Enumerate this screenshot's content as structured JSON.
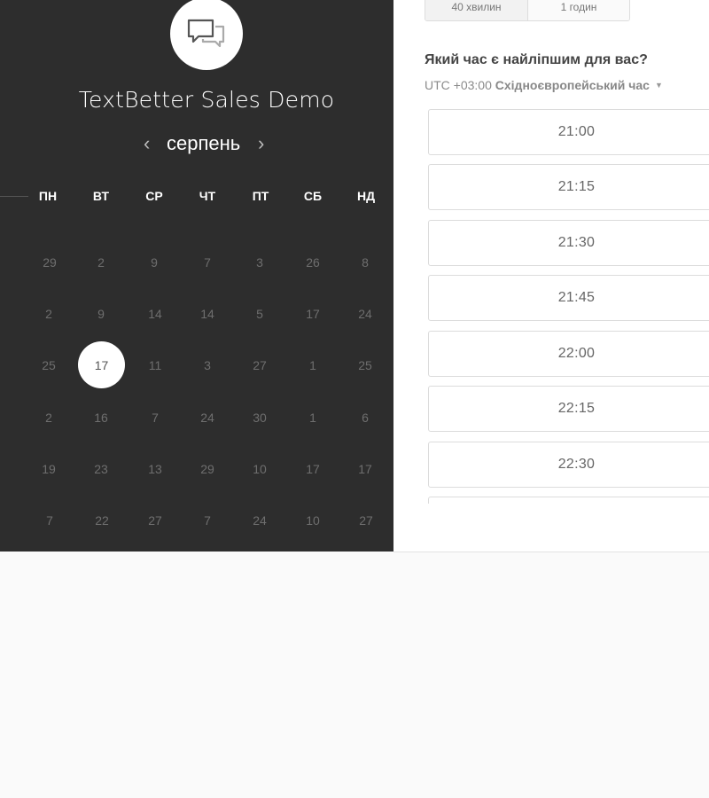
{
  "event": {
    "company_name": "TextBetter Sales Demo",
    "logo_icon": "chat-bubbles-icon"
  },
  "calendar": {
    "month": "серпень",
    "prev_icon": "chevron-left-icon",
    "next_icon": "chevron-right-icon",
    "weekdays": [
      "ПН",
      "ВТ",
      "СР",
      "ЧТ",
      "ПТ",
      "СБ",
      "НД"
    ],
    "weeks": [
      [
        "29",
        "2",
        "9",
        "7",
        "3",
        "26",
        "8"
      ],
      [
        "2",
        "9",
        "14",
        "14",
        "5",
        "17",
        "24"
      ],
      [
        "25",
        "17",
        "11",
        "3",
        "27",
        "1",
        "25"
      ],
      [
        "2",
        "16",
        "7",
        "24",
        "30",
        "1",
        "6"
      ],
      [
        "19",
        "23",
        "13",
        "29",
        "10",
        "17",
        "17"
      ],
      [
        "7",
        "22",
        "27",
        "7",
        "24",
        "10",
        "27"
      ]
    ],
    "selected_day": "17"
  },
  "duration": {
    "options": [
      "40 хвилин",
      "1 годин"
    ]
  },
  "timeslots": {
    "question": "Який час є найліпшим для вас?",
    "timezone_offset": "UTC +03:00",
    "timezone_name": "Східноєвропейський час",
    "times": [
      "21:00",
      "21:15",
      "21:30",
      "21:45",
      "22:00",
      "22:15",
      "22:30"
    ]
  },
  "colors": {
    "panel_dark": "#2d2d2d",
    "panel_light": "#ffffff",
    "page_bg": "#fafafa"
  }
}
